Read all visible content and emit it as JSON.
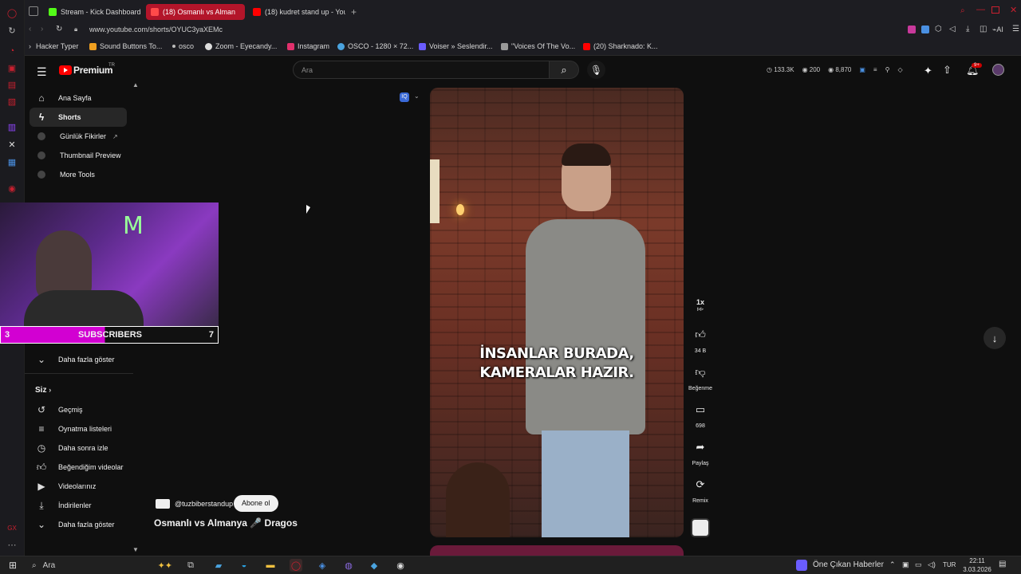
{
  "browser": {
    "tabs": [
      {
        "label": "Stream - Kick Dashboard",
        "color": "#53fc18",
        "active": false
      },
      {
        "label": "(18) Osmanlı vs Alman",
        "color": "#ff0000",
        "active": true
      },
      {
        "label": "(18) kudret stand up - You",
        "color": "#ff0000",
        "active": false
      }
    ],
    "url": "www.youtube.com/shorts/OYUC3yaXEMc",
    "bookmarks": [
      {
        "label": "Hacker Typer",
        "color": "#888"
      },
      {
        "label": "Sound Buttons To...",
        "color": "#f0a020"
      },
      {
        "label": "osco",
        "color": "#bbb"
      },
      {
        "label": "Zoom - Eyecandy...",
        "color": "#ddd"
      },
      {
        "label": "Instagram",
        "color": "#e1306c"
      },
      {
        "label": "OSCO - 1280 × 72...",
        "color": "#4aa3df"
      },
      {
        "label": "Voiser » Seslendir...",
        "color": "#6a5cff"
      },
      {
        "label": "\"Voices Of The Vo...",
        "color": "#999"
      },
      {
        "label": "(20) Sharknado: K...",
        "color": "#ff0000"
      }
    ]
  },
  "youtube": {
    "logo_text": "Premium",
    "logo_badge": "TR",
    "search_placeholder": "Ara",
    "stats": {
      "views": "133.3K",
      "watching": "200",
      "subs": "8,870"
    },
    "notification_count": "9+",
    "sidebar": {
      "top": [
        {
          "label": "Ana Sayfa",
          "icon": "home-icon"
        },
        {
          "label": "Shorts",
          "icon": "shorts-icon"
        },
        {
          "label": "Günlük Fikirler",
          "icon": "extension-icon"
        },
        {
          "label": "Thumbnail Preview",
          "icon": "extension-icon"
        },
        {
          "label": "More Tools",
          "icon": "extension-icon"
        }
      ],
      "show_more_1": "Daha fazla göster",
      "you_header": "Siz",
      "you_items": [
        {
          "label": "Geçmiş",
          "icon": "history-icon"
        },
        {
          "label": "Oynatma listeleri",
          "icon": "playlist-icon"
        },
        {
          "label": "Daha sonra izle",
          "icon": "clock-icon"
        },
        {
          "label": "Beğendiğim videolar",
          "icon": "like-icon"
        },
        {
          "label": "Videolarınız",
          "icon": "video-icon"
        },
        {
          "label": "İndirilenler",
          "icon": "download-icon"
        }
      ],
      "show_more_2": "Daha fazla göster"
    },
    "webcam": {
      "label_left": "3",
      "label_center": "SUBSCRIBERS",
      "label_right": "7"
    },
    "short": {
      "caption_line1": "İNSANLAR BURADA,",
      "caption_line2": "KAMERALAR HAZIR.",
      "channel": "@tuzbiberstandup",
      "subscribe": "Abone ol",
      "title": "Osmanlı vs Almanya 🎤 Dragos"
    },
    "actions": {
      "speed": "1x",
      "likes": "34 B",
      "dislike": "Beğenme",
      "comments": "698",
      "share": "Paylaş",
      "remix": "Remix"
    }
  },
  "taskbar": {
    "search": "Ara",
    "news": "Öne Çıkan Haberler",
    "lang": "TUR",
    "time": "22:11",
    "date": "3.03.2026"
  }
}
